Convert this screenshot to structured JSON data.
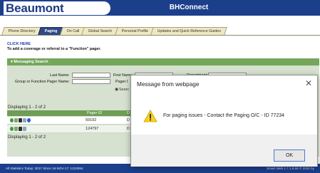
{
  "header": {
    "logo": "Beaumont",
    "app_title": "BHConnect"
  },
  "tabs": [
    {
      "label": "Phone Directory",
      "active": false
    },
    {
      "label": "Paging",
      "active": true
    },
    {
      "label": "On Call",
      "active": false
    },
    {
      "label": "Global Search",
      "active": false
    },
    {
      "label": "Personal Profile",
      "active": false
    },
    {
      "label": "Updates and Quick Reference Guides",
      "active": false
    }
  ],
  "links": {
    "click_here": "CLICK HERE",
    "instruction": "To add a coverage or referral to a \"Function\" pager."
  },
  "search_panel": {
    "title": "Messaging Search",
    "last_name_label": "Last Name:",
    "first_name_label": "First Name:",
    "department_label": "Department:",
    "group_label": "Group or Function Pager Name:",
    "pager_label": "Pager I",
    "search_label": "Searc",
    "search_icon": "binoculars-icon"
  },
  "results": {
    "displaying_top": "Displaying 1 - 2 of 2",
    "displaying_bottom": "Displaying 1 - 2 of 2",
    "columns": {
      "pager_id": "Pager ID",
      "d": "D"
    },
    "rows": [
      {
        "pager_id": "59192",
        "d": "D"
      },
      {
        "pager_id": "124797",
        "d": "D"
      }
    ]
  },
  "footer": {
    "left": "All Statistics Today: 3017 Since 16-NOV-17: 1210064",
    "right": "Smart Web 1.7.1.6.56 © 2020 by"
  },
  "dialog": {
    "title": "Message from webpage",
    "message": "For paging issues - Contact the Paging O/C - ID 77234",
    "ok_label": "OK",
    "icon": "warning-icon"
  },
  "colors": {
    "header_blue": "#1c3f8c",
    "panel_green": "#74a65c",
    "panel_bg": "#d6e1cf",
    "tab_active": "#2f4a87",
    "tab_bg": "#eee9c4"
  }
}
